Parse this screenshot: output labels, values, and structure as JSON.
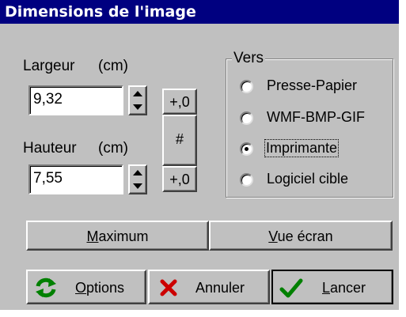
{
  "window": {
    "title": "Dimensions de l'image"
  },
  "width": {
    "label": "Largeur",
    "unit": "(cm)",
    "value": "9,32"
  },
  "height": {
    "label": "Hauteur",
    "unit": "(cm)",
    "value": "7,55"
  },
  "adjust": {
    "top_label": "+,0",
    "middle_label": "#",
    "bottom_label": "+,0"
  },
  "destination": {
    "title": "Vers",
    "options": [
      {
        "label": "Presse-Papier",
        "selected": false
      },
      {
        "label": "WMF-BMP-GIF",
        "selected": false
      },
      {
        "label": "Imprimante",
        "selected": true
      },
      {
        "label": "Logiciel cible",
        "selected": false
      }
    ]
  },
  "size_buttons": {
    "maximum_prefix": "",
    "maximum_ul": "M",
    "maximum_rest": "aximum",
    "screen_ul": "V",
    "screen_rest": "ue écran"
  },
  "actions": {
    "options_ul": "O",
    "options_rest": "ptions",
    "cancel": "Annuler",
    "run_ul": "L",
    "run_rest": "ancer"
  },
  "colors": {
    "titlebar": "#000080",
    "face": "#c0c0c0",
    "refresh_icon": "#008000",
    "cancel_icon": "#cc0000",
    "check_icon": "#008000"
  },
  "icons": {
    "options": "refresh-icon",
    "cancel": "x-icon",
    "run": "checkmark-icon"
  }
}
